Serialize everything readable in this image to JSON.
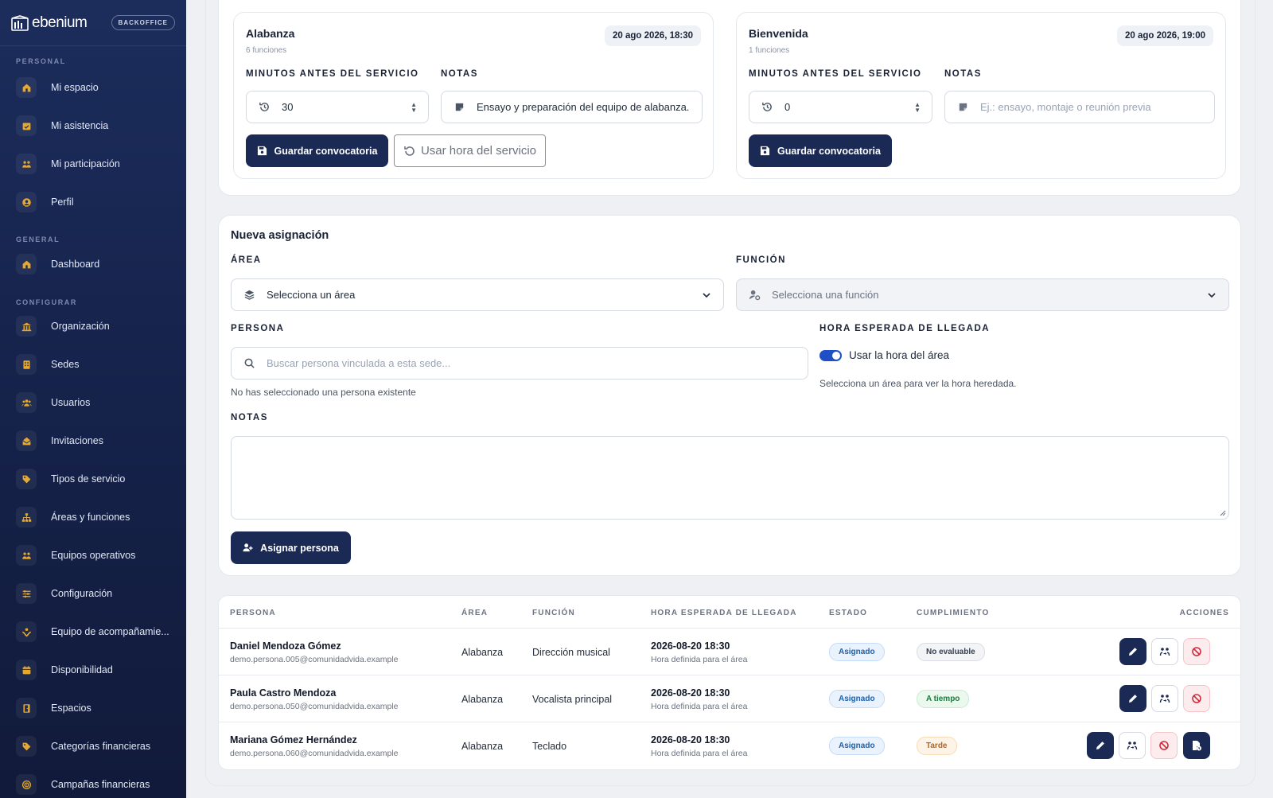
{
  "brand": {
    "name": "ebenium",
    "tag": "BACKOFFICE"
  },
  "sidebar": {
    "sections": [
      "PERSONAL",
      "GENERAL",
      "CONFIGURAR"
    ],
    "items": [
      {
        "label": "Mi espacio",
        "icon": "home-icon"
      },
      {
        "label": "Mi asistencia",
        "icon": "calendar-check-icon"
      },
      {
        "label": "Mi participación",
        "icon": "people-icon"
      },
      {
        "label": "Perfil",
        "icon": "user-circle-icon"
      },
      {
        "label": "Dashboard",
        "icon": "home-icon"
      },
      {
        "label": "Organización",
        "icon": "bank-icon"
      },
      {
        "label": "Sedes",
        "icon": "building-icon"
      },
      {
        "label": "Usuarios",
        "icon": "users-icon"
      },
      {
        "label": "Invitaciones",
        "icon": "invite-icon"
      },
      {
        "label": "Tipos de servicio",
        "icon": "tag-icon"
      },
      {
        "label": "Áreas y funciones",
        "icon": "sitemap-icon"
      },
      {
        "label": "Equipos operativos",
        "icon": "people-icon"
      },
      {
        "label": "Configuración",
        "icon": "sliders-icon"
      },
      {
        "label": "Equipo de acompañamie...",
        "icon": "hands-icon"
      },
      {
        "label": "Disponibilidad",
        "icon": "calendar-icon"
      },
      {
        "label": "Espacios",
        "icon": "door-icon"
      },
      {
        "label": "Categorías financieras",
        "icon": "tag-icon"
      },
      {
        "label": "Campañas financieras",
        "icon": "target-icon"
      }
    ]
  },
  "cards": [
    {
      "title": "Alabanza",
      "subtitle": "6 funciones",
      "date": "20 ago 2026, 18:30",
      "minutes_label": "MINUTOS ANTES DEL SERVICIO",
      "minutes_value": "30",
      "notes_label": "NOTAS",
      "notes_value": "Ensayo y preparación del equipo de alabanza.",
      "notes_placeholder": "",
      "save_label": "Guardar convocatoria",
      "reset_label": "Usar hora del servicio"
    },
    {
      "title": "Bienvenida",
      "subtitle": "1 funciones",
      "date": "20 ago 2026, 19:00",
      "minutes_label": "MINUTOS ANTES DEL SERVICIO",
      "minutes_value": "0",
      "notes_label": "NOTAS",
      "notes_value": "",
      "notes_placeholder": "Ej.: ensayo, montaje o reunión previa",
      "save_label": "Guardar convocatoria"
    }
  ],
  "assign": {
    "title": "Nueva asignación",
    "area_label": "ÁREA",
    "area_value": "Selecciona un área",
    "function_label": "FUNCIÓN",
    "function_value": "Selecciona una función",
    "person_label": "PERSONA",
    "person_placeholder": "Buscar persona vinculada a esta sede...",
    "person_hint": "No has seleccionado una persona existente",
    "arrival_label": "HORA ESPERADA DE LLEGADA",
    "toggle_label": "Usar la hora del área",
    "toggle_on": true,
    "arrival_hint": "Selecciona un área para ver la hora heredada.",
    "notes_label": "NOTAS",
    "notes_value": "",
    "submit_label": "Asignar persona"
  },
  "table": {
    "headers": [
      "PERSONA",
      "ÁREA",
      "FUNCIÓN",
      "HORA ESPERADA DE LLEGADA",
      "ESTADO",
      "CUMPLIMIENTO",
      "ACCIONES"
    ],
    "rows": [
      {
        "name": "Daniel Mendoza Gómez",
        "email": "demo.persona.005@comunidadvida.example",
        "area": "Alabanza",
        "function": "Dirección musical",
        "time": "2026-08-20 18:30",
        "time_note": "Hora definida para el área",
        "status": "Asignado",
        "compliance": "No evaluable",
        "compliance_tone": "gray"
      },
      {
        "name": "Paula Castro Mendoza",
        "email": "demo.persona.050@comunidadvida.example",
        "area": "Alabanza",
        "function": "Vocalista principal",
        "time": "2026-08-20 18:30",
        "time_note": "Hora definida para el área",
        "status": "Asignado",
        "compliance": "A tiempo",
        "compliance_tone": "green"
      },
      {
        "name": "Mariana Gómez Hernández",
        "email": "demo.persona.060@comunidadvida.example",
        "area": "Alabanza",
        "function": "Teclado",
        "time": "2026-08-20 18:30",
        "time_note": "Hora definida para el área",
        "status": "Asignado",
        "compliance": "Tarde",
        "compliance_tone": "orange"
      }
    ]
  },
  "colors": {
    "accent": "#1b2a55",
    "sidebar": "#1c2d5c",
    "toggle": "#1e4fc7"
  }
}
